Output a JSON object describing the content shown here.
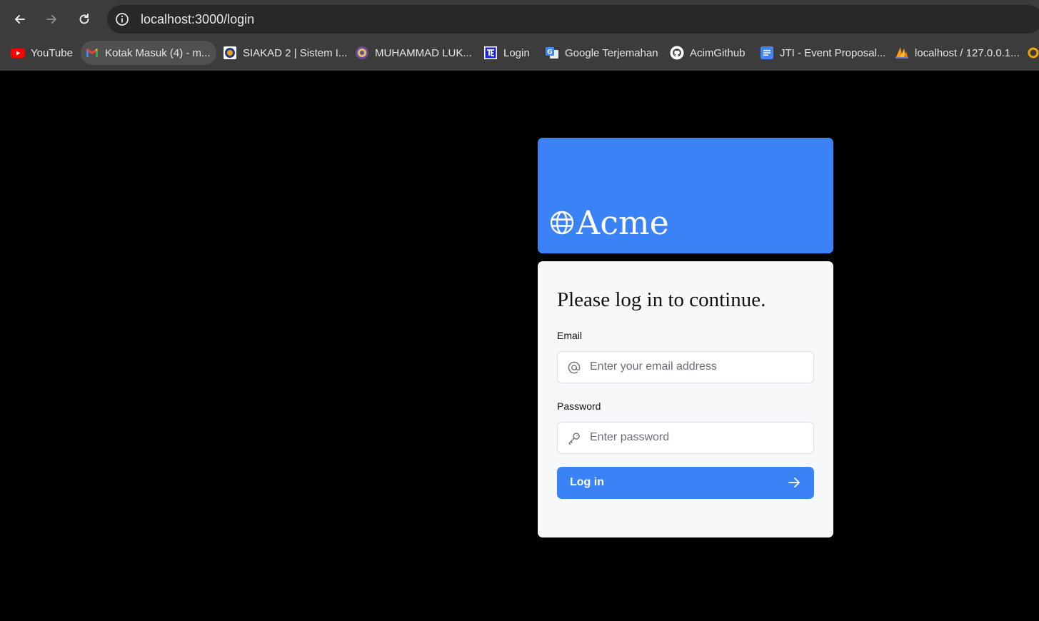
{
  "browser": {
    "url": "localhost:3000/login",
    "bookmarks": [
      {
        "label": "YouTube",
        "icon": "youtube-icon"
      },
      {
        "label": "Kotak Masuk (4) - m...",
        "icon": "gmail-icon"
      },
      {
        "label": "SIAKAD 2 | Sistem I...",
        "icon": "siakad-icon"
      },
      {
        "label": "MUHAMMAD LUK...",
        "icon": "emblem-icon"
      },
      {
        "label": "Login",
        "icon": "te-icon"
      },
      {
        "label": "Google Terjemahan",
        "icon": "google-translate-icon"
      },
      {
        "label": "AcimGithub",
        "icon": "github-icon"
      },
      {
        "label": "JTI - Event Proposal...",
        "icon": "google-docs-icon"
      },
      {
        "label": "localhost / 127.0.0.1...",
        "icon": "phpmyadmin-icon"
      }
    ]
  },
  "brand": {
    "name": "Acme",
    "color": "#3b82f6"
  },
  "login": {
    "heading": "Please log in to continue.",
    "email_label": "Email",
    "email_placeholder": "Enter your email address",
    "password_label": "Password",
    "password_placeholder": "Enter password",
    "submit_label": "Log in"
  }
}
